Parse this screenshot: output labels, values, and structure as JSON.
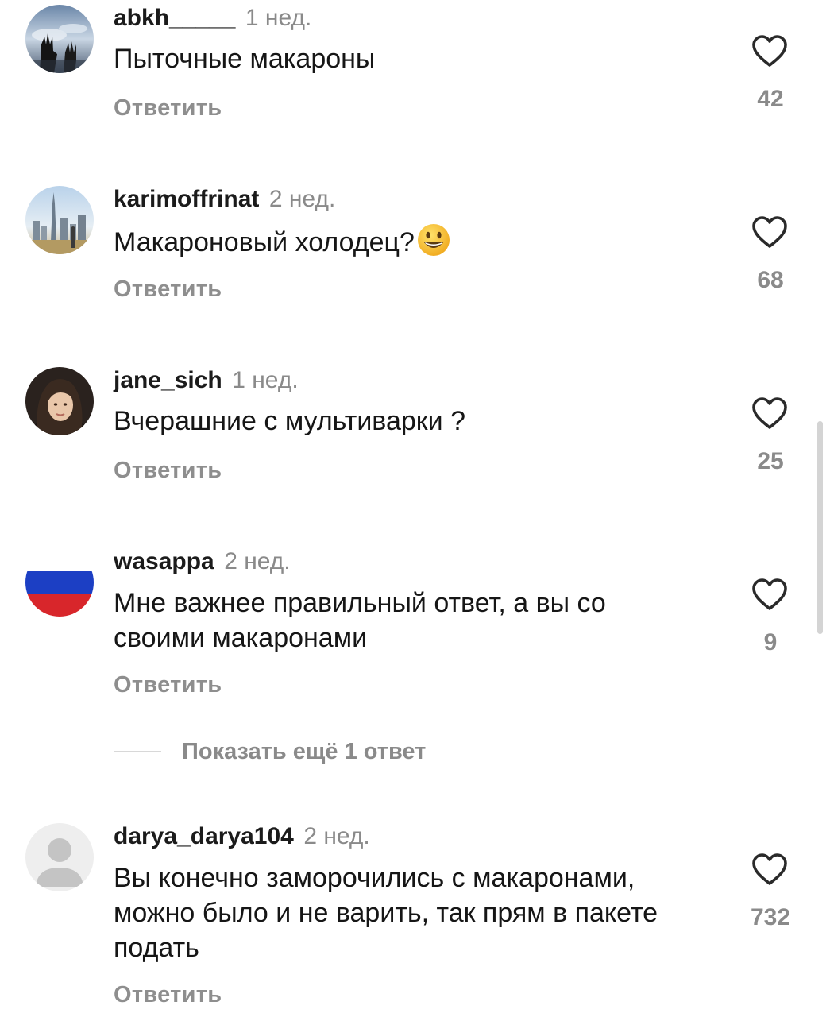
{
  "comments": [
    {
      "username": "abkh_____",
      "time": "1 нед.",
      "text": "Пыточные макароны",
      "reply": "Ответить",
      "likes": "42",
      "avatar": "hands-sky-photo"
    },
    {
      "username": "karimoffrinat",
      "time": "2 нед.",
      "text": "Макароновый холодец?",
      "emoji": "smiley-face-emoji",
      "reply": "Ответить",
      "likes": "68",
      "avatar": "city-skyline-photo"
    },
    {
      "username": "jane_sich",
      "time": "1 нед.",
      "text": "Вчерашние с мультиварки ?",
      "reply": "Ответить",
      "likes": "25",
      "avatar": "portrait-photo"
    },
    {
      "username": "wasappa",
      "time": "2 нед.",
      "text": "Мне важнее правильный ответ, а вы со своими макаронами",
      "reply": "Ответить",
      "likes": "9",
      "avatar": "russian-flag"
    },
    {
      "username": "darya_darya104",
      "time": "2 нед.",
      "text": "Вы конечно заморочились с макаронами, можно было и не варить, так прям в пакете подать",
      "reply": "Ответить",
      "likes": "732",
      "avatar": "default-user"
    }
  ],
  "show_more_replies": "Показать ещё 1 ответ",
  "colors": {
    "username": "#1b1b1b",
    "secondary": "#8a8a8a",
    "flag_white": "#ffffff",
    "flag_blue": "#1c3fc4",
    "flag_red": "#d8262b"
  }
}
